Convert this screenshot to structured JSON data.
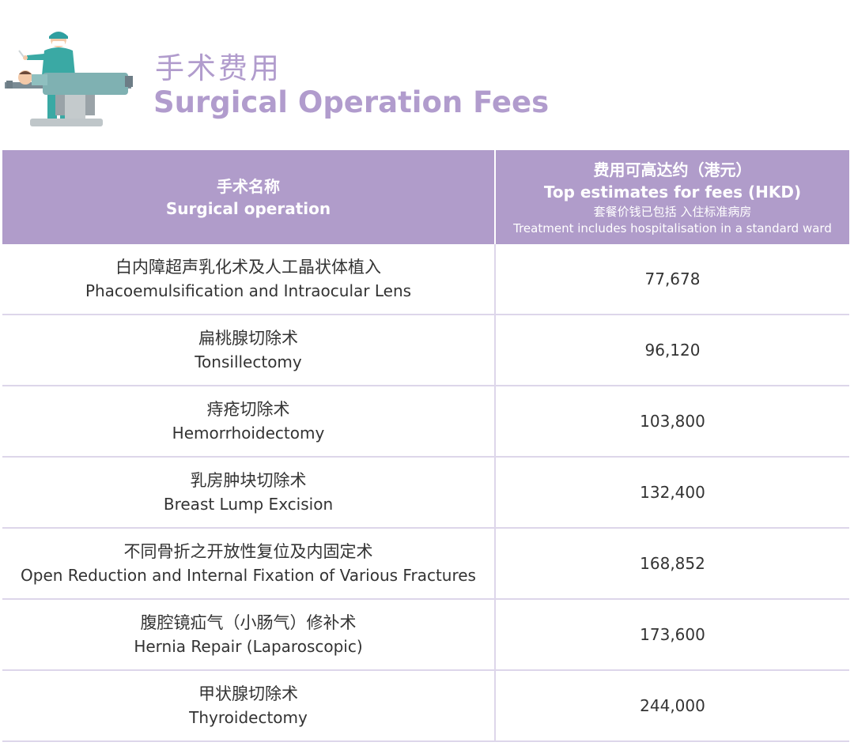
{
  "header": {
    "title_zh": "手术费用",
    "title_en": "Surgical Operation Fees",
    "illustration_icon": "surgeon-operating-table-icon"
  },
  "table": {
    "header": {
      "operation_zh": "手术名称",
      "operation_en": "Surgical operation",
      "fee_zh": "费用可高达约（港元）",
      "fee_en": "Top estimates for fees (HKD)",
      "note_zh": "套餐价钱已包括 入住标准病房",
      "note_en": "Treatment includes hospitalisation in a standard ward"
    },
    "rows": [
      {
        "zh": "白内障超声乳化术及人工晶状体植入",
        "en": "Phacoemulsification and Intraocular Lens",
        "fee": "77,678"
      },
      {
        "zh": "扁桃腺切除术",
        "en": "Tonsillectomy",
        "fee": "96,120"
      },
      {
        "zh": "痔疮切除术",
        "en": "Hemorrhoidectomy",
        "fee": "103,800"
      },
      {
        "zh": "乳房肿块切除术",
        "en": "Breast Lump Excision",
        "fee": "132,400"
      },
      {
        "zh": "不同骨折之开放性复位及内固定术",
        "en": "Open Reduction and Internal Fixation of Various Fractures",
        "fee": "168,852"
      },
      {
        "zh": "腹腔镜疝气（小肠气）修补术",
        "en": "Hernia Repair (Laparoscopic)",
        "fee": "173,600"
      },
      {
        "zh": "甲状腺切除术",
        "en": "Thyroidectomy",
        "fee": "244,000"
      }
    ]
  },
  "colors": {
    "accent": "#b09cca",
    "title": "#b19ccd",
    "divider": "#ddd6ea"
  }
}
